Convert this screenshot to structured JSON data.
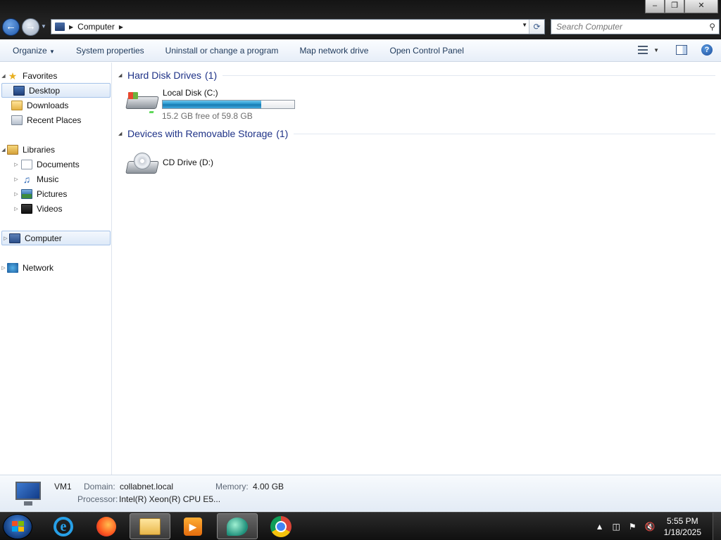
{
  "window": {
    "controls": [
      "minimize",
      "maximize",
      "close"
    ],
    "back_icon": "back-arrow-icon",
    "forward_icon": "forward-arrow-icon"
  },
  "address_bar": {
    "breadcrumb": "Computer",
    "icon": "computer-icon"
  },
  "search": {
    "placeholder": "Search Computer"
  },
  "toolbar": {
    "organize": "Organize",
    "system_properties": "System properties",
    "uninstall": "Uninstall or change a program",
    "map_drive": "Map network drive",
    "control_panel": "Open Control Panel"
  },
  "nav": {
    "favorites": "Favorites",
    "desktop": "Desktop",
    "downloads": "Downloads",
    "recent_places": "Recent Places",
    "libraries": "Libraries",
    "documents": "Documents",
    "music": "Music",
    "pictures": "Pictures",
    "videos": "Videos",
    "computer": "Computer",
    "network": "Network"
  },
  "groups": {
    "hdd": {
      "title": "Hard Disk Drives",
      "count": "(1)"
    },
    "removable": {
      "title": "Devices with Removable Storage",
      "count": "(1)"
    }
  },
  "drives": {
    "c": {
      "name": "Local Disk (C:)",
      "free_text": "15.2 GB free of 59.8 GB",
      "used_fraction": 0.746
    },
    "d": {
      "name": "CD Drive (D:)"
    }
  },
  "details": {
    "name": "VM1",
    "domain_label": "Domain:",
    "domain_value": "collabnet.local",
    "memory_label": "Memory:",
    "memory_value": "4.00 GB",
    "processor_label": "Processor:",
    "processor_value": "Intel(R) Xeon(R) CPU E5..."
  },
  "taskbar": {
    "apps": [
      "internet-explorer",
      "firefox",
      "windows-explorer",
      "windows-media-player",
      "vm-app",
      "chrome"
    ],
    "time": "5:55 PM",
    "date": "1/18/2025"
  },
  "colors": {
    "accent": "#1e3287",
    "selection": "#dde9f8",
    "progress": "#1f8fc8"
  }
}
